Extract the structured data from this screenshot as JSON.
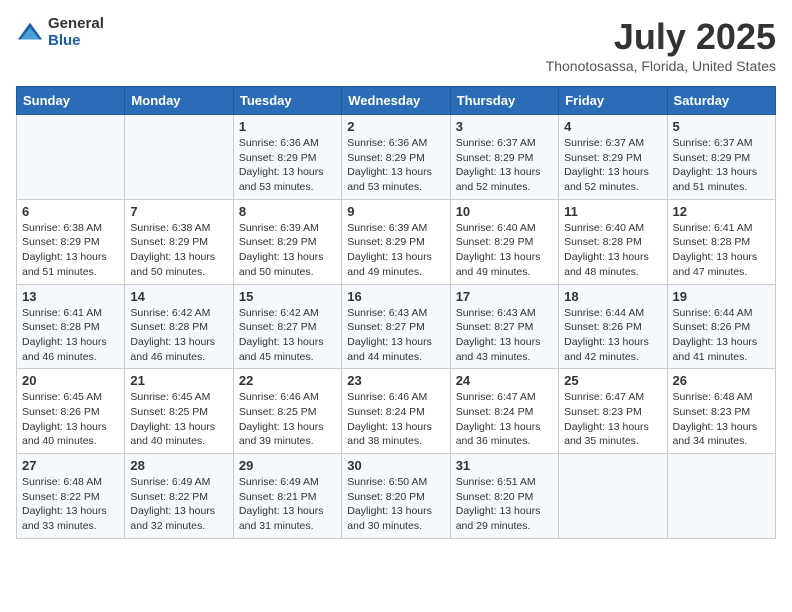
{
  "logo": {
    "general": "General",
    "blue": "Blue"
  },
  "header": {
    "title": "July 2025",
    "subtitle": "Thonotosassa, Florida, United States"
  },
  "weekdays": [
    "Sunday",
    "Monday",
    "Tuesday",
    "Wednesday",
    "Thursday",
    "Friday",
    "Saturday"
  ],
  "weeks": [
    [
      {
        "day": "",
        "info": ""
      },
      {
        "day": "",
        "info": ""
      },
      {
        "day": "1",
        "info": "Sunrise: 6:36 AM\nSunset: 8:29 PM\nDaylight: 13 hours and 53 minutes."
      },
      {
        "day": "2",
        "info": "Sunrise: 6:36 AM\nSunset: 8:29 PM\nDaylight: 13 hours and 53 minutes."
      },
      {
        "day": "3",
        "info": "Sunrise: 6:37 AM\nSunset: 8:29 PM\nDaylight: 13 hours and 52 minutes."
      },
      {
        "day": "4",
        "info": "Sunrise: 6:37 AM\nSunset: 8:29 PM\nDaylight: 13 hours and 52 minutes."
      },
      {
        "day": "5",
        "info": "Sunrise: 6:37 AM\nSunset: 8:29 PM\nDaylight: 13 hours and 51 minutes."
      }
    ],
    [
      {
        "day": "6",
        "info": "Sunrise: 6:38 AM\nSunset: 8:29 PM\nDaylight: 13 hours and 51 minutes."
      },
      {
        "day": "7",
        "info": "Sunrise: 6:38 AM\nSunset: 8:29 PM\nDaylight: 13 hours and 50 minutes."
      },
      {
        "day": "8",
        "info": "Sunrise: 6:39 AM\nSunset: 8:29 PM\nDaylight: 13 hours and 50 minutes."
      },
      {
        "day": "9",
        "info": "Sunrise: 6:39 AM\nSunset: 8:29 PM\nDaylight: 13 hours and 49 minutes."
      },
      {
        "day": "10",
        "info": "Sunrise: 6:40 AM\nSunset: 8:29 PM\nDaylight: 13 hours and 49 minutes."
      },
      {
        "day": "11",
        "info": "Sunrise: 6:40 AM\nSunset: 8:28 PM\nDaylight: 13 hours and 48 minutes."
      },
      {
        "day": "12",
        "info": "Sunrise: 6:41 AM\nSunset: 8:28 PM\nDaylight: 13 hours and 47 minutes."
      }
    ],
    [
      {
        "day": "13",
        "info": "Sunrise: 6:41 AM\nSunset: 8:28 PM\nDaylight: 13 hours and 46 minutes."
      },
      {
        "day": "14",
        "info": "Sunrise: 6:42 AM\nSunset: 8:28 PM\nDaylight: 13 hours and 46 minutes."
      },
      {
        "day": "15",
        "info": "Sunrise: 6:42 AM\nSunset: 8:27 PM\nDaylight: 13 hours and 45 minutes."
      },
      {
        "day": "16",
        "info": "Sunrise: 6:43 AM\nSunset: 8:27 PM\nDaylight: 13 hours and 44 minutes."
      },
      {
        "day": "17",
        "info": "Sunrise: 6:43 AM\nSunset: 8:27 PM\nDaylight: 13 hours and 43 minutes."
      },
      {
        "day": "18",
        "info": "Sunrise: 6:44 AM\nSunset: 8:26 PM\nDaylight: 13 hours and 42 minutes."
      },
      {
        "day": "19",
        "info": "Sunrise: 6:44 AM\nSunset: 8:26 PM\nDaylight: 13 hours and 41 minutes."
      }
    ],
    [
      {
        "day": "20",
        "info": "Sunrise: 6:45 AM\nSunset: 8:26 PM\nDaylight: 13 hours and 40 minutes."
      },
      {
        "day": "21",
        "info": "Sunrise: 6:45 AM\nSunset: 8:25 PM\nDaylight: 13 hours and 40 minutes."
      },
      {
        "day": "22",
        "info": "Sunrise: 6:46 AM\nSunset: 8:25 PM\nDaylight: 13 hours and 39 minutes."
      },
      {
        "day": "23",
        "info": "Sunrise: 6:46 AM\nSunset: 8:24 PM\nDaylight: 13 hours and 38 minutes."
      },
      {
        "day": "24",
        "info": "Sunrise: 6:47 AM\nSunset: 8:24 PM\nDaylight: 13 hours and 36 minutes."
      },
      {
        "day": "25",
        "info": "Sunrise: 6:47 AM\nSunset: 8:23 PM\nDaylight: 13 hours and 35 minutes."
      },
      {
        "day": "26",
        "info": "Sunrise: 6:48 AM\nSunset: 8:23 PM\nDaylight: 13 hours and 34 minutes."
      }
    ],
    [
      {
        "day": "27",
        "info": "Sunrise: 6:48 AM\nSunset: 8:22 PM\nDaylight: 13 hours and 33 minutes."
      },
      {
        "day": "28",
        "info": "Sunrise: 6:49 AM\nSunset: 8:22 PM\nDaylight: 13 hours and 32 minutes."
      },
      {
        "day": "29",
        "info": "Sunrise: 6:49 AM\nSunset: 8:21 PM\nDaylight: 13 hours and 31 minutes."
      },
      {
        "day": "30",
        "info": "Sunrise: 6:50 AM\nSunset: 8:20 PM\nDaylight: 13 hours and 30 minutes."
      },
      {
        "day": "31",
        "info": "Sunrise: 6:51 AM\nSunset: 8:20 PM\nDaylight: 13 hours and 29 minutes."
      },
      {
        "day": "",
        "info": ""
      },
      {
        "day": "",
        "info": ""
      }
    ]
  ]
}
